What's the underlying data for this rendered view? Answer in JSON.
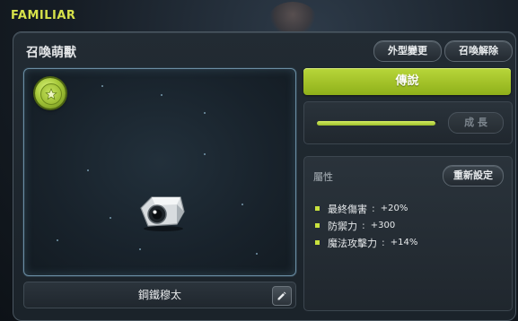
{
  "window": {
    "title": "FAMILIAR"
  },
  "panel": {
    "title": "召喚萌獸",
    "appearance_change_label": "外型變更",
    "dismiss_label": "召喚解除"
  },
  "familiar": {
    "name": "鋼鐵穆太",
    "rank": "傳說",
    "growth_button_label": "成 長",
    "growth_progress": 0.98
  },
  "attributes": {
    "title": "屬性",
    "reset_label": "重新設定",
    "items": [
      {
        "name": "最終傷害",
        "sep": ":",
        "value": "+20%"
      },
      {
        "name": "防禦力",
        "sep": ":",
        "value": "+300"
      },
      {
        "name": "魔法攻擊力",
        "sep": ":",
        "value": "+14%"
      }
    ]
  },
  "icons": {
    "badge": "star-badge-icon",
    "edit": "pencil-icon",
    "creature": "steel-familiar-creature"
  },
  "colors": {
    "title": "#d6e14a",
    "rank_green": "#a5c52a",
    "bullet": "#c9e23e",
    "viewer_border": "#6b8ea4"
  }
}
